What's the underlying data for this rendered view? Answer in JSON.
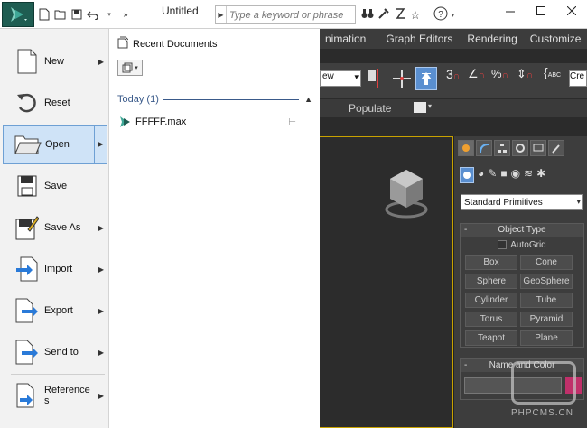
{
  "titlebar": {
    "doc_title": "Untitled",
    "search_placeholder": "Type a keyword or phrase"
  },
  "menubar": {
    "items": [
      "nimation",
      "Graph Editors",
      "Rendering",
      "Customize"
    ]
  },
  "toolbar": {
    "view_dropdown": "ew",
    "name_field": "Cre"
  },
  "subtabs": {
    "populate": "Populate"
  },
  "app_menu": {
    "commands": [
      {
        "label": "New",
        "icon": "new-doc-icon",
        "submenu": true
      },
      {
        "label": "Reset",
        "icon": "reset-icon",
        "submenu": false
      },
      {
        "label": "Open",
        "icon": "open-folder-icon",
        "submenu": true,
        "active": true
      },
      {
        "label": "Save",
        "icon": "save-icon",
        "submenu": false
      },
      {
        "label": "Save As",
        "icon": "save-as-icon",
        "submenu": true
      },
      {
        "label": "Import",
        "icon": "import-icon",
        "submenu": true
      },
      {
        "label": "Export",
        "icon": "export-icon",
        "submenu": true
      },
      {
        "label": "Send to",
        "icon": "send-to-icon",
        "submenu": true
      },
      {
        "label": "Reference\ns",
        "icon": "references-icon",
        "submenu": true
      }
    ],
    "recent": {
      "title": "Recent Documents",
      "group": "Today (1)",
      "files": [
        {
          "name": "FFFFF.max",
          "pinned": false
        }
      ]
    }
  },
  "command_panel": {
    "dropdown": "Standard Primitives",
    "object_type": {
      "title": "Object Type",
      "autogrid": "AutoGrid",
      "buttons": [
        "Box",
        "Cone",
        "Sphere",
        "GeoSphere",
        "Cylinder",
        "Tube",
        "Torus",
        "Pyramid",
        "Teapot",
        "Plane"
      ]
    },
    "name_color": {
      "title": "Name and Color"
    }
  },
  "watermark": {
    "text": "PHPCMS.CN"
  },
  "colors": {
    "accent": "#1f5d52",
    "selection": "#cfe3f7",
    "viewport_border": "#c8a200"
  }
}
